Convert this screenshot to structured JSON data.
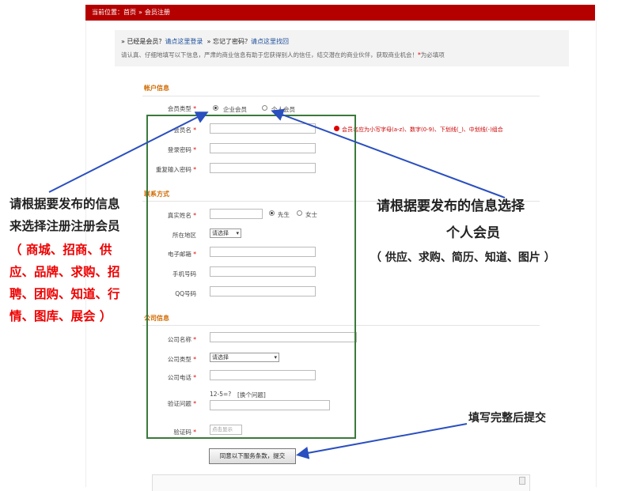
{
  "breadcrumb": {
    "prefix": "当前位置：",
    "home": "首页",
    "sep": "»",
    "current": "会员注册"
  },
  "notice": {
    "already_prefix": "» 已经是会员？",
    "login_link": "请点这里登录",
    "forgot_prefix": "» 忘记了密码？",
    "forgot_link": "请点这里找回",
    "instruction": "请认真、仔细地填写以下信息，严肃的商业信息有助于您获得别人的信任，结交潜在的商业伙伴，获取商业机会！",
    "required_mark": "*",
    "required_note": "为必填项"
  },
  "account": {
    "title": "帐户信息",
    "member_type_label": "会员类型",
    "member_type_options": [
      "企业会员",
      "个人会员"
    ],
    "selected_member_type": "企业会员",
    "username_label": "会员名",
    "username_hint": "会员名应为小写字母(a-z)、数字(0-9)、下划线(_)、中划线(-)组合",
    "password_label": "登录密码",
    "repeat_password_label": "重复输入密码"
  },
  "contact": {
    "title": "联系方式",
    "realname_label": "真实姓名",
    "gender_options": [
      "先生",
      "女士"
    ],
    "selected_gender": "先生",
    "region_label": "所在地区",
    "region_value": "请选择",
    "email_label": "电子邮箱",
    "mobile_label": "手机号码",
    "qq_label": "QQ号码"
  },
  "company": {
    "title": "公司信息",
    "name_label": "公司名称",
    "type_label": "公司类型",
    "type_value": "请选择",
    "phone_label": "公司电话",
    "question_label": "验证问题",
    "question_text": "12-5=?",
    "change_question": "[换个问题]",
    "captcha_label": "验证码",
    "captcha_button": "点击显示"
  },
  "submit_label": "同意以下服务条款，提交",
  "annotations": {
    "left_line1": "请根据要发布的信息",
    "left_line2": "来选择注册注册会员",
    "left_red": [
      "（ 商城、招商、供",
      "应、品牌、求购、招",
      "聘、团购、知道、行",
      "情、图库、展会 ）"
    ],
    "right_line1": "请根据要发布的信息选择",
    "right_line2": "个人会员",
    "right_line3": "（ 供应、求购、简历、知道、图片 ）",
    "submit_note": "填写完整后提交"
  },
  "colors": {
    "header_red": "#b50000",
    "section_orange": "#d06a00",
    "link_blue": "#1a4d99",
    "annotation_green": "#3a7a3a",
    "arrow_blue": "#2a4fbf",
    "annotation_red": "#e00000"
  }
}
